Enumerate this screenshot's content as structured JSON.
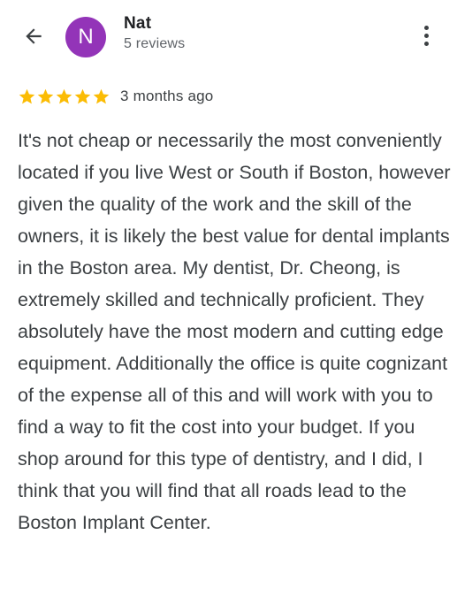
{
  "header": {
    "back_icon": "arrow-left-icon",
    "avatar_initial": "N",
    "avatar_color": "#9334b8",
    "reviewer_name": "Nat",
    "reviewer_meta": "5 reviews",
    "more_icon": "more-vertical-icon"
  },
  "review": {
    "rating": 5,
    "rating_max": 5,
    "star_color": "#fbbc04",
    "date": "3 months ago",
    "text": "It's not cheap or necessarily the most conveniently located if you live West or South if Boston, however given the quality of the work and the skill of the owners, it is likely the best value for dental implants in the Boston area. My dentist, Dr. Cheong, is extremely skilled and technically proficient. They absolutely have the most modern and cutting edge equipment. Additionally the office is quite cognizant of the expense all of this and will work with you to find a way to fit the cost into your budget. If you shop around for this type of dentistry, and I did, I think that you will find that all roads lead to the Boston Implant Center."
  }
}
